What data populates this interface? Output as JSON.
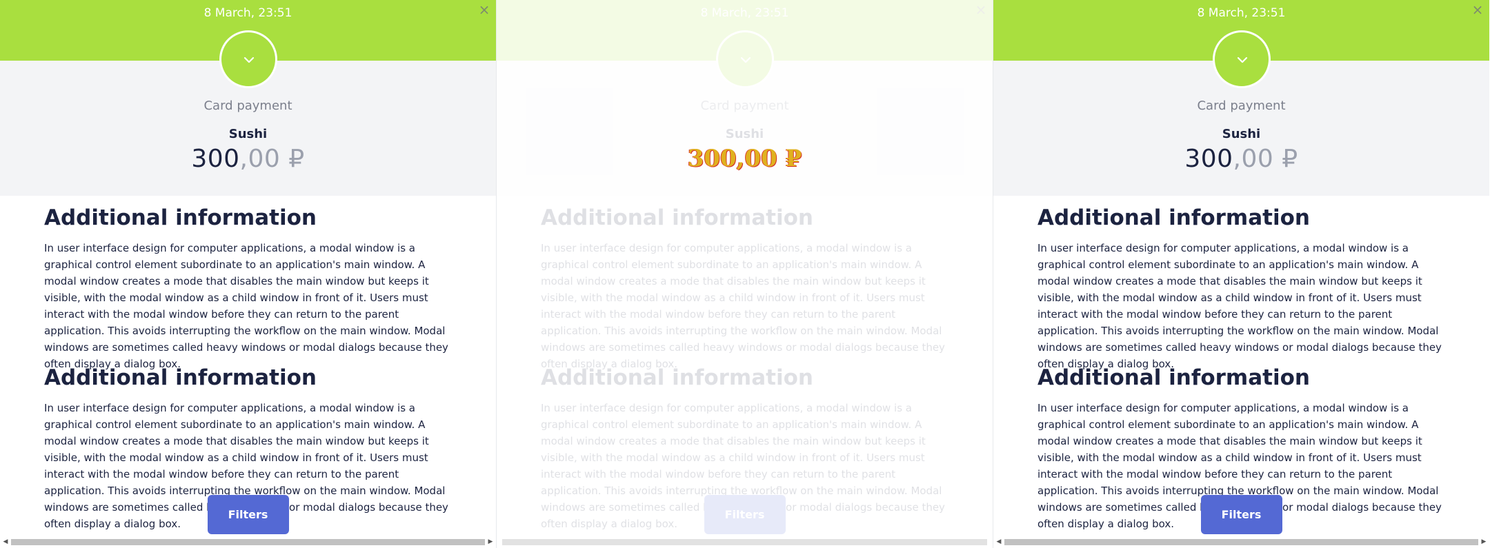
{
  "panels": [
    {
      "date": "8 March, 23:51",
      "close_icon": "×",
      "payment_method": "Card payment",
      "merchant": "Sushi",
      "amount_int": "300",
      "amount_dec": ",00",
      "currency": "₽",
      "sections": [
        {
          "heading": "Additional information",
          "text": "In user interface design for computer applications, a modal window is a graphical control element subordinate to an application's main window. A modal window creates a mode that disables the main window but keeps it visible, with the modal window as a child window in front of it. Users must interact with the modal window before they can return to the parent application. This avoids interrupting the workflow on the main window. Modal windows are sometimes called heavy windows or modal dialogs because they often display a dialog box."
        },
        {
          "heading": "Additional information",
          "text": "In user interface design for computer applications, a modal window is a graphical control element subordinate to an application's main window. A modal window creates a mode that disables the main window but keeps it visible, with the modal window as a child window in front of it. Users must interact with the modal window before they can return to the parent application. This avoids interrupting the workflow on the main window. Modal windows are sometimes called heavy windows or modal dialogs because they often display a dialog box."
        }
      ],
      "filters_label": "Filters"
    },
    {
      "date": "8 March, 23:51",
      "close_icon": "×",
      "payment_method": "Card payment",
      "merchant": "Sushi",
      "amount_full": "300,00 ₽",
      "sections": [
        {
          "heading": "Additional information",
          "text": "In user interface design for computer applications, a modal window is a graphical control element subordinate to an application's main window. A modal window creates a mode that disables the main window but keeps it visible, with the modal window as a child window in front of it. Users must interact with the modal window before they can return to the parent application. This avoids interrupting the workflow on the main window. Modal windows are sometimes called heavy windows or modal dialogs because they often display a dialog box."
        },
        {
          "heading": "Additional information",
          "text": "In user interface design for computer applications, a modal window is a graphical control element subordinate to an application's main window. A modal window creates a mode that disables the main window but keeps it visible, with the modal window as a child window in front of it. Users must interact with the modal window before they can return to the parent application. This avoids interrupting the workflow on the main window. Modal windows are sometimes called heavy windows or modal dialogs because they often display a dialog box."
        }
      ],
      "filters_label": "Filters"
    },
    {
      "date": "8 March, 23:51",
      "close_icon": "×",
      "payment_method": "Card payment",
      "merchant": "Sushi",
      "amount_int": "300",
      "amount_dec": ",00",
      "currency": "₽",
      "sections": [
        {
          "heading": "Additional information",
          "text": "In user interface design for computer applications, a modal window is a graphical control element subordinate to an application's main window. A modal window creates a mode that disables the main window but keeps it visible, with the modal window as a child window in front of it. Users must interact with the modal window before they can return to the parent application. This avoids interrupting the workflow on the main window. Modal windows are sometimes called heavy windows or modal dialogs because they often display a dialog box."
        },
        {
          "heading": "Additional information",
          "text": "In user interface design for computer applications, a modal window is a graphical control element subordinate to an application's main window. A modal window creates a mode that disables the main window but keeps it visible, with the modal window as a child window in front of it. Users must interact with the modal window before they can return to the parent application. This avoids interrupting the workflow on the main window. Modal windows are sometimes called heavy windows or modal dialogs because they often display a dialog box."
        }
      ],
      "filters_label": "Filters"
    }
  ],
  "icons": {
    "status": "chevron-down-icon",
    "close": "close-icon",
    "scroll_left": "arrow-left-icon",
    "scroll_right": "arrow-right-icon"
  },
  "scroll_glyphs": {
    "left": "◀",
    "right": "▶"
  },
  "colors": {
    "accent_green": "#a9df3f",
    "button_blue": "#5469d4",
    "text_dark": "#1c2340"
  }
}
